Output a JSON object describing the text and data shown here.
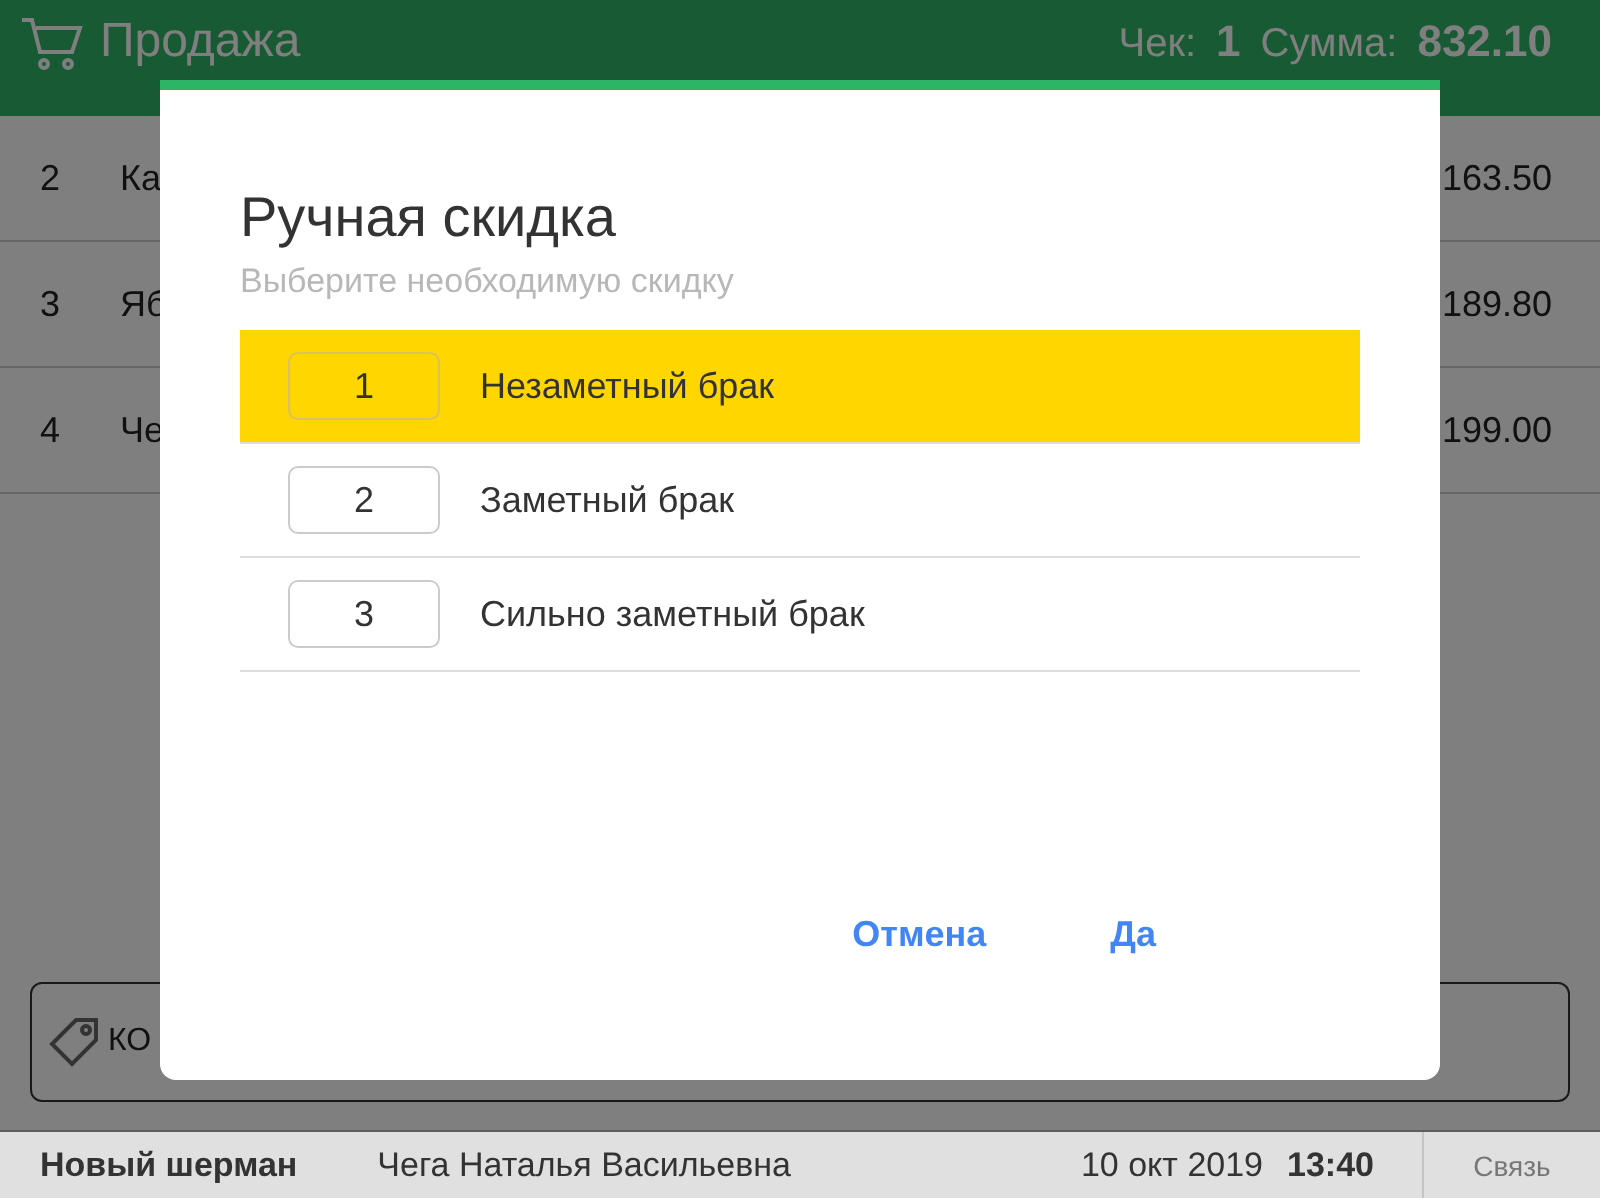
{
  "header": {
    "title": "Продажа",
    "receipt_label": "Чек:",
    "receipt_number": "1",
    "sum_label": "Сумма:",
    "sum_value": "832.10"
  },
  "rows": [
    {
      "number": "2",
      "name": "Ка",
      "price": "163.50"
    },
    {
      "number": "3",
      "name": "Яб",
      "price": "189.80"
    },
    {
      "number": "4",
      "name": "Че",
      "price": "199.00"
    }
  ],
  "code_field": {
    "placeholder": "КО"
  },
  "dialog": {
    "title": "Ручная скидка",
    "subtitle": "Выберите необходимую скидку",
    "options": [
      {
        "key": "1",
        "label": "Незаметный брак",
        "selected": true
      },
      {
        "key": "2",
        "label": "Заметный брак",
        "selected": false
      },
      {
        "key": "3",
        "label": "Сильно заметный брак",
        "selected": false
      }
    ],
    "buttons": [
      "Отмена",
      "Да"
    ]
  },
  "status_bar": {
    "store": "Новый шерман",
    "cashier": "Чега Наталья Васильевна",
    "date": "10 окт 2019",
    "time": "13:40",
    "connection": "Связь"
  }
}
